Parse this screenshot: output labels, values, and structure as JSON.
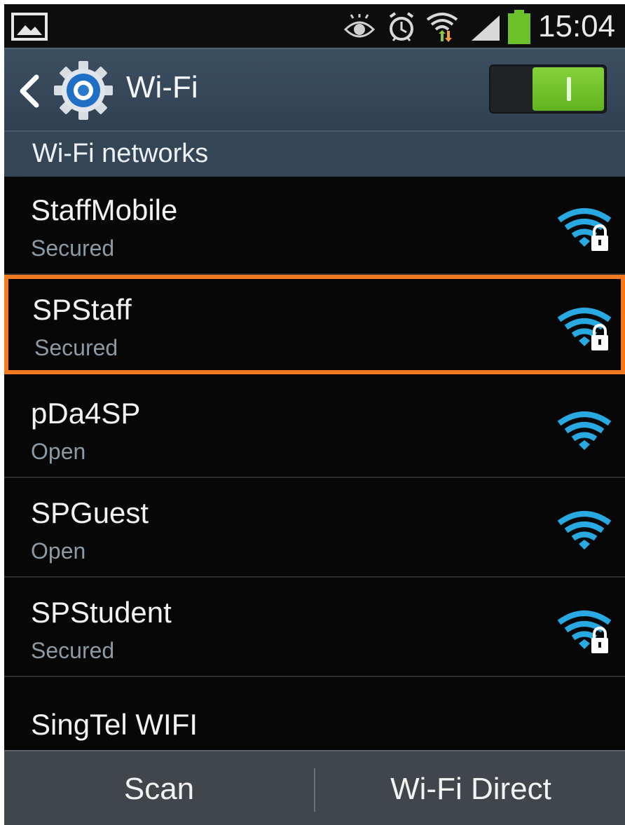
{
  "status_bar": {
    "time": "15:04",
    "icons": [
      "gallery-icon",
      "eye-icon",
      "alarm-icon",
      "wifi-status-icon",
      "signal-icon",
      "battery-icon"
    ]
  },
  "header": {
    "title": "Wi-Fi",
    "toggle_state": "on",
    "accent": "#6cc12a"
  },
  "section": {
    "label": "Wi-Fi networks"
  },
  "networks": [
    {
      "name": "StaffMobile",
      "status": "Secured",
      "secured": true
    },
    {
      "name": "SPStaff",
      "status": "Secured",
      "secured": true,
      "highlighted": true
    },
    {
      "name": "pDa4SP",
      "status": "Open",
      "secured": false
    },
    {
      "name": "SPGuest",
      "status": "Open",
      "secured": false
    },
    {
      "name": "SPStudent",
      "status": "Secured",
      "secured": true
    },
    {
      "name": "SingTel WIFI",
      "status": "",
      "secured": false
    }
  ],
  "bottom_bar": {
    "scan_label": "Scan",
    "direct_label": "Wi-Fi Direct"
  },
  "colors": {
    "highlight": "#f47a20",
    "wifi_blue": "#29a9e1"
  }
}
